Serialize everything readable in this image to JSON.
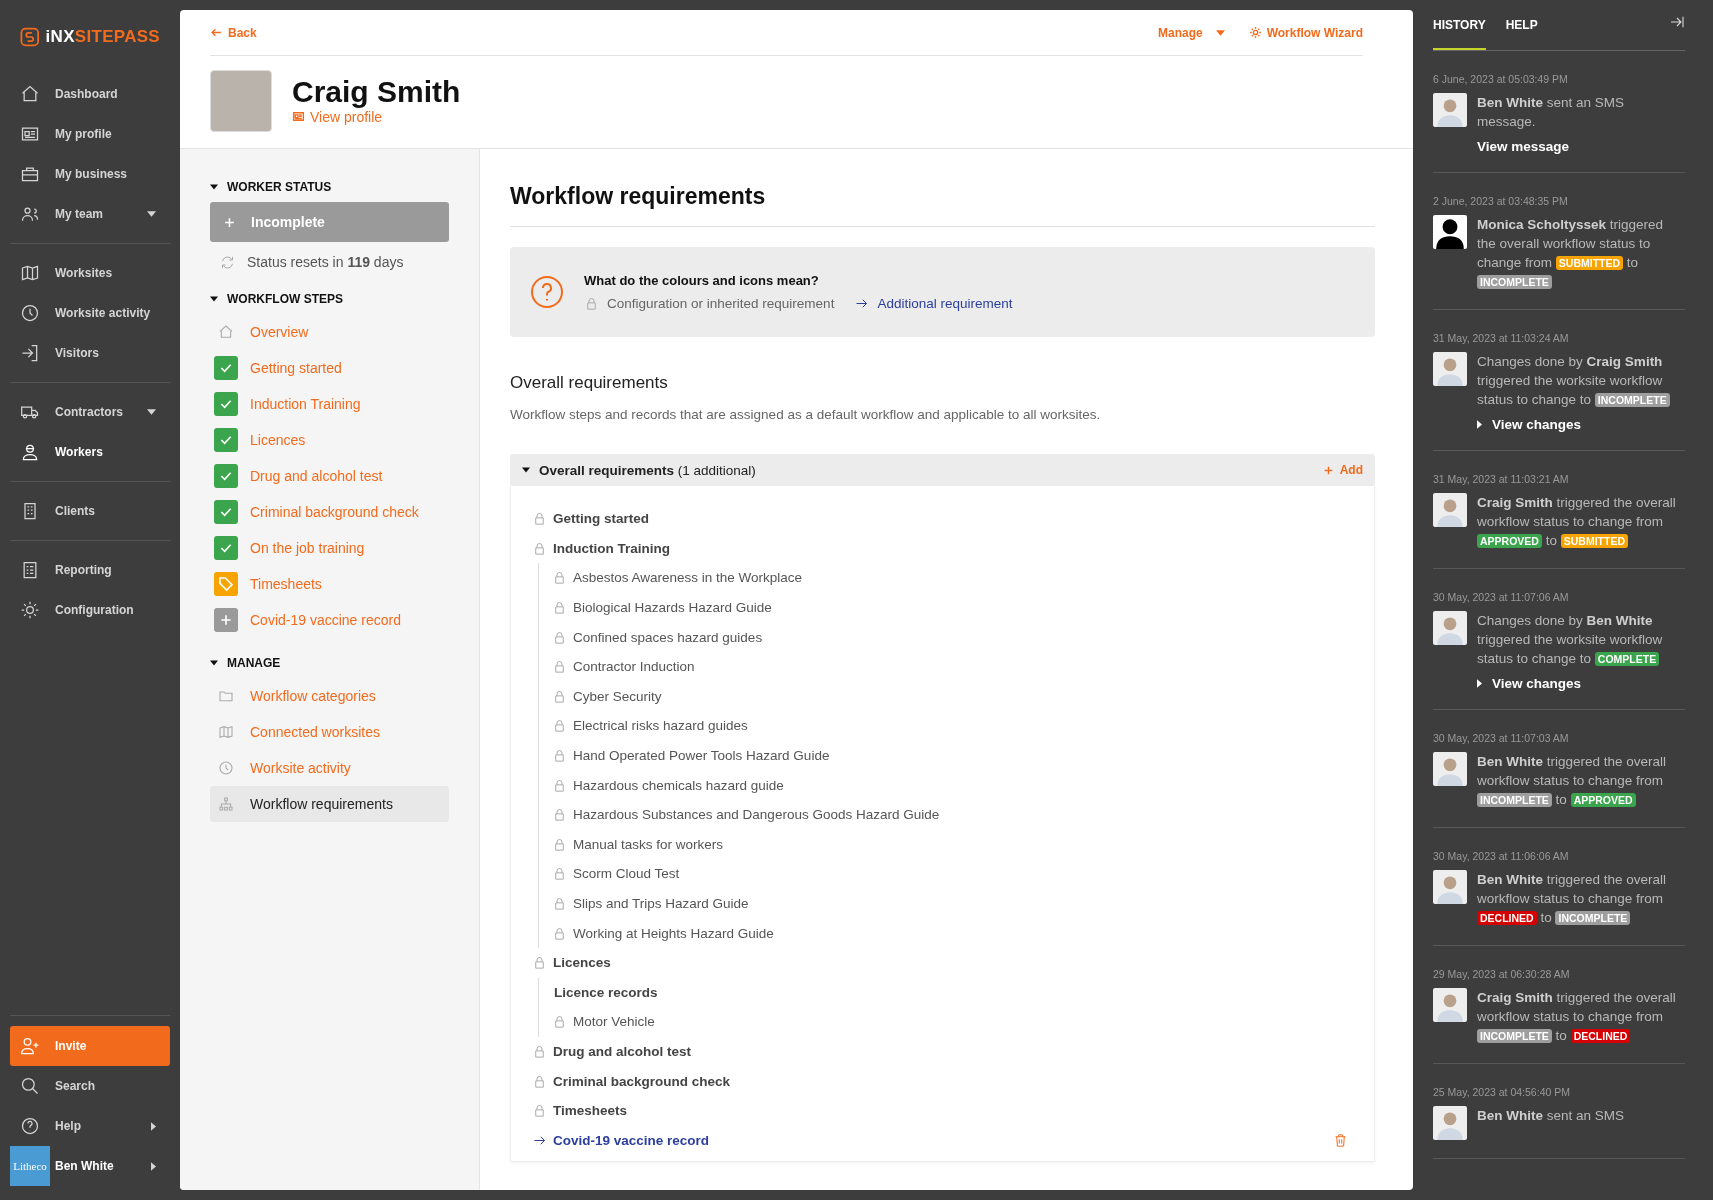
{
  "logo": {
    "prefix": "iNX",
    "name": "SITEPASS"
  },
  "nav": {
    "groups": [
      [
        {
          "label": "Dashboard",
          "selected": false,
          "has_menu": false
        },
        {
          "label": "My profile",
          "selected": false,
          "has_menu": false
        },
        {
          "label": "My business",
          "selected": false,
          "has_menu": false
        },
        {
          "label": "My team",
          "selected": false,
          "has_menu": true
        }
      ],
      [
        {
          "label": "Worksites",
          "selected": false,
          "has_menu": false
        },
        {
          "label": "Worksite activity",
          "selected": false,
          "has_menu": false
        },
        {
          "label": "Visitors",
          "selected": false,
          "has_menu": false
        }
      ],
      [
        {
          "label": "Contractors",
          "selected": false,
          "has_menu": true
        },
        {
          "label": "Workers",
          "selected": true,
          "has_menu": false
        }
      ],
      [
        {
          "label": "Clients",
          "selected": false,
          "has_menu": false
        }
      ],
      [
        {
          "label": "Reporting",
          "selected": false,
          "has_menu": false
        },
        {
          "label": "Configuration",
          "selected": false,
          "has_menu": false
        }
      ]
    ],
    "bottom": [
      {
        "kind": "invite",
        "label": "Invite"
      },
      {
        "kind": "search",
        "label": "Search",
        "has_menu": false
      },
      {
        "kind": "help",
        "label": "Help",
        "has_menu": true
      },
      {
        "kind": "account",
        "logo_text": "Litheco",
        "label": "Ben White",
        "has_menu": true
      }
    ]
  },
  "header": {
    "back": "Back",
    "manage": "Manage",
    "wizard": "Workflow Wizard"
  },
  "profile": {
    "name": "Craig Smith",
    "link": "View profile"
  },
  "worker_status": {
    "title": "WORKER STATUS",
    "status": "Incomplete",
    "reset": "Status resets in **119** days"
  },
  "workflow_steps": {
    "title": "WORKFLOW STEPS",
    "items": [
      {
        "kind": "overview",
        "label": "Overview"
      },
      {
        "kind": "complete",
        "label": "Getting started"
      },
      {
        "kind": "complete",
        "label": "Induction Training"
      },
      {
        "kind": "complete",
        "label": "Licences"
      },
      {
        "kind": "complete",
        "label": "Drug and alcohol test"
      },
      {
        "kind": "complete",
        "label": "Criminal background check"
      },
      {
        "kind": "complete",
        "label": "On the job training"
      },
      {
        "kind": "timesheet",
        "label": "Timesheets"
      },
      {
        "kind": "pending",
        "label": "Covid-19 vaccine record"
      }
    ]
  },
  "manage": {
    "title": "MANAGE",
    "items": [
      {
        "label": "Workflow categories",
        "selected": false
      },
      {
        "label": "Connected worksites",
        "selected": false
      },
      {
        "label": "Worksite activity",
        "selected": false
      },
      {
        "label": "Workflow requirements",
        "selected": true
      }
    ]
  },
  "page_title": "Workflow requirements",
  "legend": {
    "question": "What do the colours and icons mean?",
    "inherited": "Configuration or inherited requirement",
    "additional": "Additional requirement"
  },
  "section": {
    "title": "Overall requirements",
    "description": "Workflow steps and records that are assigned as a default workflow and applicable to all worksites."
  },
  "requirements": {
    "title": "Overall requirements",
    "note": "(1 additional)",
    "add": "Add",
    "expanded": true,
    "items": [
      {
        "kind": "inherited",
        "label": "Getting started"
      },
      {
        "kind": "inherited",
        "label": "Induction Training",
        "children": [
          {
            "kind": "inherited",
            "label": "Asbestos Awareness in the Workplace"
          },
          {
            "kind": "inherited",
            "label": "Biological Hazards Hazard Guide"
          },
          {
            "kind": "inherited",
            "label": "Confined spaces hazard guides"
          },
          {
            "kind": "inherited",
            "label": "Contractor Induction"
          },
          {
            "kind": "inherited",
            "label": "Cyber Security"
          },
          {
            "kind": "inherited",
            "label": "Electrical risks hazard guides"
          },
          {
            "kind": "inherited",
            "label": "Hand Operated Power Tools Hazard Guide"
          },
          {
            "kind": "inherited",
            "label": "Hazardous chemicals hazard guide"
          },
          {
            "kind": "inherited",
            "label": "Hazardous Substances and Dangerous Goods Hazard Guide"
          },
          {
            "kind": "inherited",
            "label": "Manual tasks for workers"
          },
          {
            "kind": "inherited",
            "label": "Scorm Cloud Test"
          },
          {
            "kind": "inherited",
            "label": "Slips and Trips Hazard Guide"
          },
          {
            "kind": "inherited",
            "label": "Working at Heights Hazard Guide"
          }
        ]
      },
      {
        "kind": "inherited",
        "label": "Licences",
        "children": [
          {
            "kind": "heading",
            "label": "Licence records"
          },
          {
            "kind": "inherited",
            "label": "Motor Vehicle"
          }
        ]
      },
      {
        "kind": "inherited",
        "label": "Drug and alcohol test"
      },
      {
        "kind": "inherited",
        "label": "Criminal background check"
      },
      {
        "kind": "inherited",
        "label": "Timesheets"
      },
      {
        "kind": "additional",
        "label": "Covid-19 vaccine record"
      }
    ]
  },
  "panel": {
    "tabs": [
      {
        "label": "HISTORY",
        "selected": true
      },
      {
        "label": "HELP",
        "selected": false
      }
    ],
    "history": [
      {
        "date": "6 June, 2023 at 05:03:49 PM",
        "kind": "photo",
        "parts": [
          {
            "kind": "name",
            "text": "Ben White"
          },
          {
            "kind": "text",
            "text": "sent an SMS message."
          }
        ],
        "link": {
          "kind": "plain",
          "text": "View message"
        }
      },
      {
        "date": "2 June, 2023 at 03:48:35 PM",
        "kind": "silhouette",
        "parts": [
          {
            "kind": "name",
            "text": "Monica Scholtyssek"
          },
          {
            "kind": "text",
            "text": "triggered the overall workflow status to change from"
          },
          {
            "kind": "badge",
            "text": "SUBMITTED",
            "color": "#f7a400"
          },
          {
            "kind": "text",
            "text": "to"
          },
          {
            "kind": "badge",
            "text": "INCOMPLETE",
            "color": "#9e9e9e"
          }
        ]
      },
      {
        "date": "31 May, 2023 at 11:03:24 AM",
        "kind": "photo",
        "parts": [
          {
            "kind": "text",
            "text": "Changes done by"
          },
          {
            "kind": "name",
            "text": "Craig Smith"
          },
          {
            "kind": "text",
            "text": "triggered the worksite workflow status to change to"
          },
          {
            "kind": "badge",
            "text": "INCOMPLETE",
            "color": "#9e9e9e"
          }
        ],
        "link": {
          "kind": "expander",
          "text": "View changes"
        }
      },
      {
        "date": "31 May, 2023 at 11:03:21 AM",
        "kind": "photo",
        "parts": [
          {
            "kind": "name",
            "text": "Craig Smith"
          },
          {
            "kind": "text",
            "text": "triggered the overall workflow status to change from"
          },
          {
            "kind": "badge",
            "text": "APPROVED",
            "color": "#3ba54e"
          },
          {
            "kind": "text",
            "text": "to"
          },
          {
            "kind": "badge",
            "text": "SUBMITTED",
            "color": "#f7a400"
          }
        ]
      },
      {
        "date": "30 May, 2023 at 11:07:06 AM",
        "kind": "photo",
        "parts": [
          {
            "kind": "text",
            "text": "Changes done by"
          },
          {
            "kind": "name",
            "text": "Ben White"
          },
          {
            "kind": "text",
            "text": "triggered the worksite workflow status to change to"
          },
          {
            "kind": "badge",
            "text": "COMPLETE",
            "color": "#3ba54e"
          }
        ],
        "link": {
          "kind": "expander",
          "text": "View changes"
        }
      },
      {
        "date": "30 May, 2023 at 11:07:03 AM",
        "kind": "photo",
        "parts": [
          {
            "kind": "name",
            "text": "Ben White"
          },
          {
            "kind": "text",
            "text": "triggered the overall workflow status to change from"
          },
          {
            "kind": "badge",
            "text": "INCOMPLETE",
            "color": "#9e9e9e"
          },
          {
            "kind": "text",
            "text": "to"
          },
          {
            "kind": "badge",
            "text": "APPROVED",
            "color": "#3ba54e"
          }
        ]
      },
      {
        "date": "30 May, 2023 at 11:06:06 AM",
        "kind": "photo",
        "parts": [
          {
            "kind": "name",
            "text": "Ben White"
          },
          {
            "kind": "text",
            "text": "triggered the overall workflow status to change from"
          },
          {
            "kind": "badge",
            "text": "DECLINED",
            "color": "#d50000"
          },
          {
            "kind": "text",
            "text": "to"
          },
          {
            "kind": "badge",
            "text": "INCOMPLETE",
            "color": "#9e9e9e"
          }
        ]
      },
      {
        "date": "29 May, 2023 at 06:30:28 AM",
        "kind": "photo",
        "parts": [
          {
            "kind": "name",
            "text": "Craig Smith"
          },
          {
            "kind": "text",
            "text": "triggered the overall workflow status to change from"
          },
          {
            "kind": "badge",
            "text": "INCOMPLETE",
            "color": "#9e9e9e"
          },
          {
            "kind": "text",
            "text": "to"
          },
          {
            "kind": "badge",
            "text": "DECLINED",
            "color": "#d50000"
          }
        ]
      },
      {
        "date": "25 May, 2023 at 04:56:40 PM",
        "kind": "photo",
        "parts": [
          {
            "kind": "name",
            "text": "Ben White"
          },
          {
            "kind": "text",
            "text": "sent an SMS"
          }
        ]
      }
    ]
  }
}
